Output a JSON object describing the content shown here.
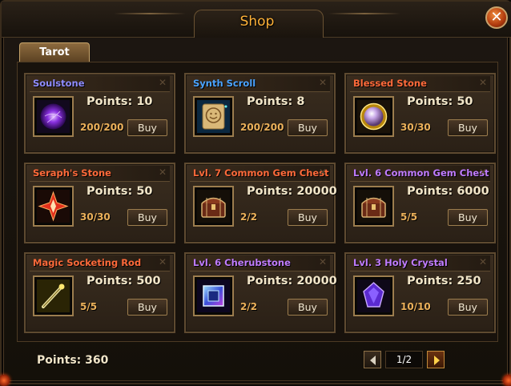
{
  "window": {
    "title": "Shop"
  },
  "tabs": [
    {
      "label": "Tarot"
    }
  ],
  "labels": {
    "points_prefix": "Points:",
    "buy": "Buy"
  },
  "items": [
    {
      "name": "Soulstone",
      "name_color": "#8f8cff",
      "points": "10",
      "stock": "200/200",
      "icon": "soulstone-icon"
    },
    {
      "name": "Synth Scroll",
      "name_color": "#4aa3ff",
      "points": "8",
      "stock": "200/200",
      "icon": "synth-scroll-icon"
    },
    {
      "name": "Blessed Stone",
      "name_color": "#ff6a3a",
      "points": "50",
      "stock": "30/30",
      "icon": "blessed-stone-icon"
    },
    {
      "name": "Seraph's Stone",
      "name_color": "#ff6a3a",
      "points": "50",
      "stock": "30/30",
      "icon": "seraphs-stone-icon"
    },
    {
      "name": "Lvl. 7 Common Gem Chest",
      "name_color": "#ff6a3a",
      "points": "20000",
      "stock": "2/2",
      "icon": "gem-chest-icon"
    },
    {
      "name": "Lvl. 6 Common Gem Chest",
      "name_color": "#c07cff",
      "points": "6000",
      "stock": "5/5",
      "icon": "gem-chest-icon"
    },
    {
      "name": "Magic Socketing Rod",
      "name_color": "#ff6a3a",
      "points": "500",
      "stock": "5/5",
      "icon": "socketing-rod-icon"
    },
    {
      "name": "Lvl. 6 Cherubstone",
      "name_color": "#c07cff",
      "points": "20000",
      "stock": "2/2",
      "icon": "cherubstone-icon"
    },
    {
      "name": "Lvl. 3 Holy Crystal",
      "name_color": "#c07cff",
      "points": "250",
      "stock": "10/10",
      "icon": "holy-crystal-icon"
    }
  ],
  "footer": {
    "points_label": "Points:",
    "points_value": "360",
    "page": "1/2"
  }
}
